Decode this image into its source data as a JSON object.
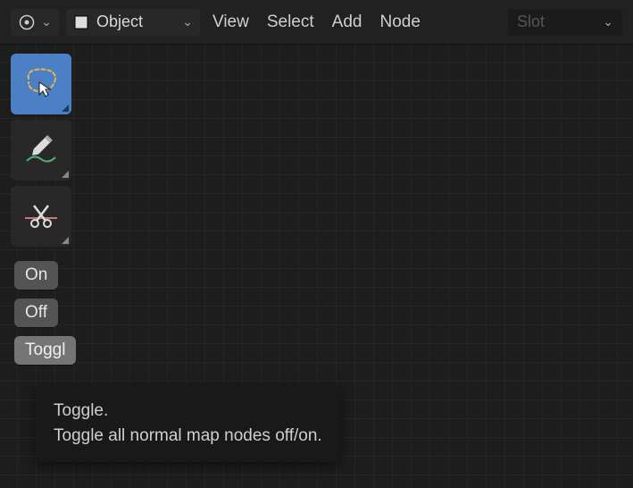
{
  "header": {
    "mode_dropdown_icon": "node-editor-icon",
    "object_label": "Object",
    "menus": [
      "View",
      "Select",
      "Add",
      "Node"
    ],
    "slot_label": "Slot"
  },
  "toolbar": {
    "tools": [
      {
        "name": "select-tool",
        "active": true
      },
      {
        "name": "annotate-tool",
        "active": false
      },
      {
        "name": "links-cut-tool",
        "active": false
      }
    ]
  },
  "side_buttons": {
    "on_label": "On",
    "off_label": "Off",
    "toggle_label": "Toggl"
  },
  "tooltip": {
    "title": "Toggle.",
    "body": "Toggle all normal map nodes off/on."
  }
}
